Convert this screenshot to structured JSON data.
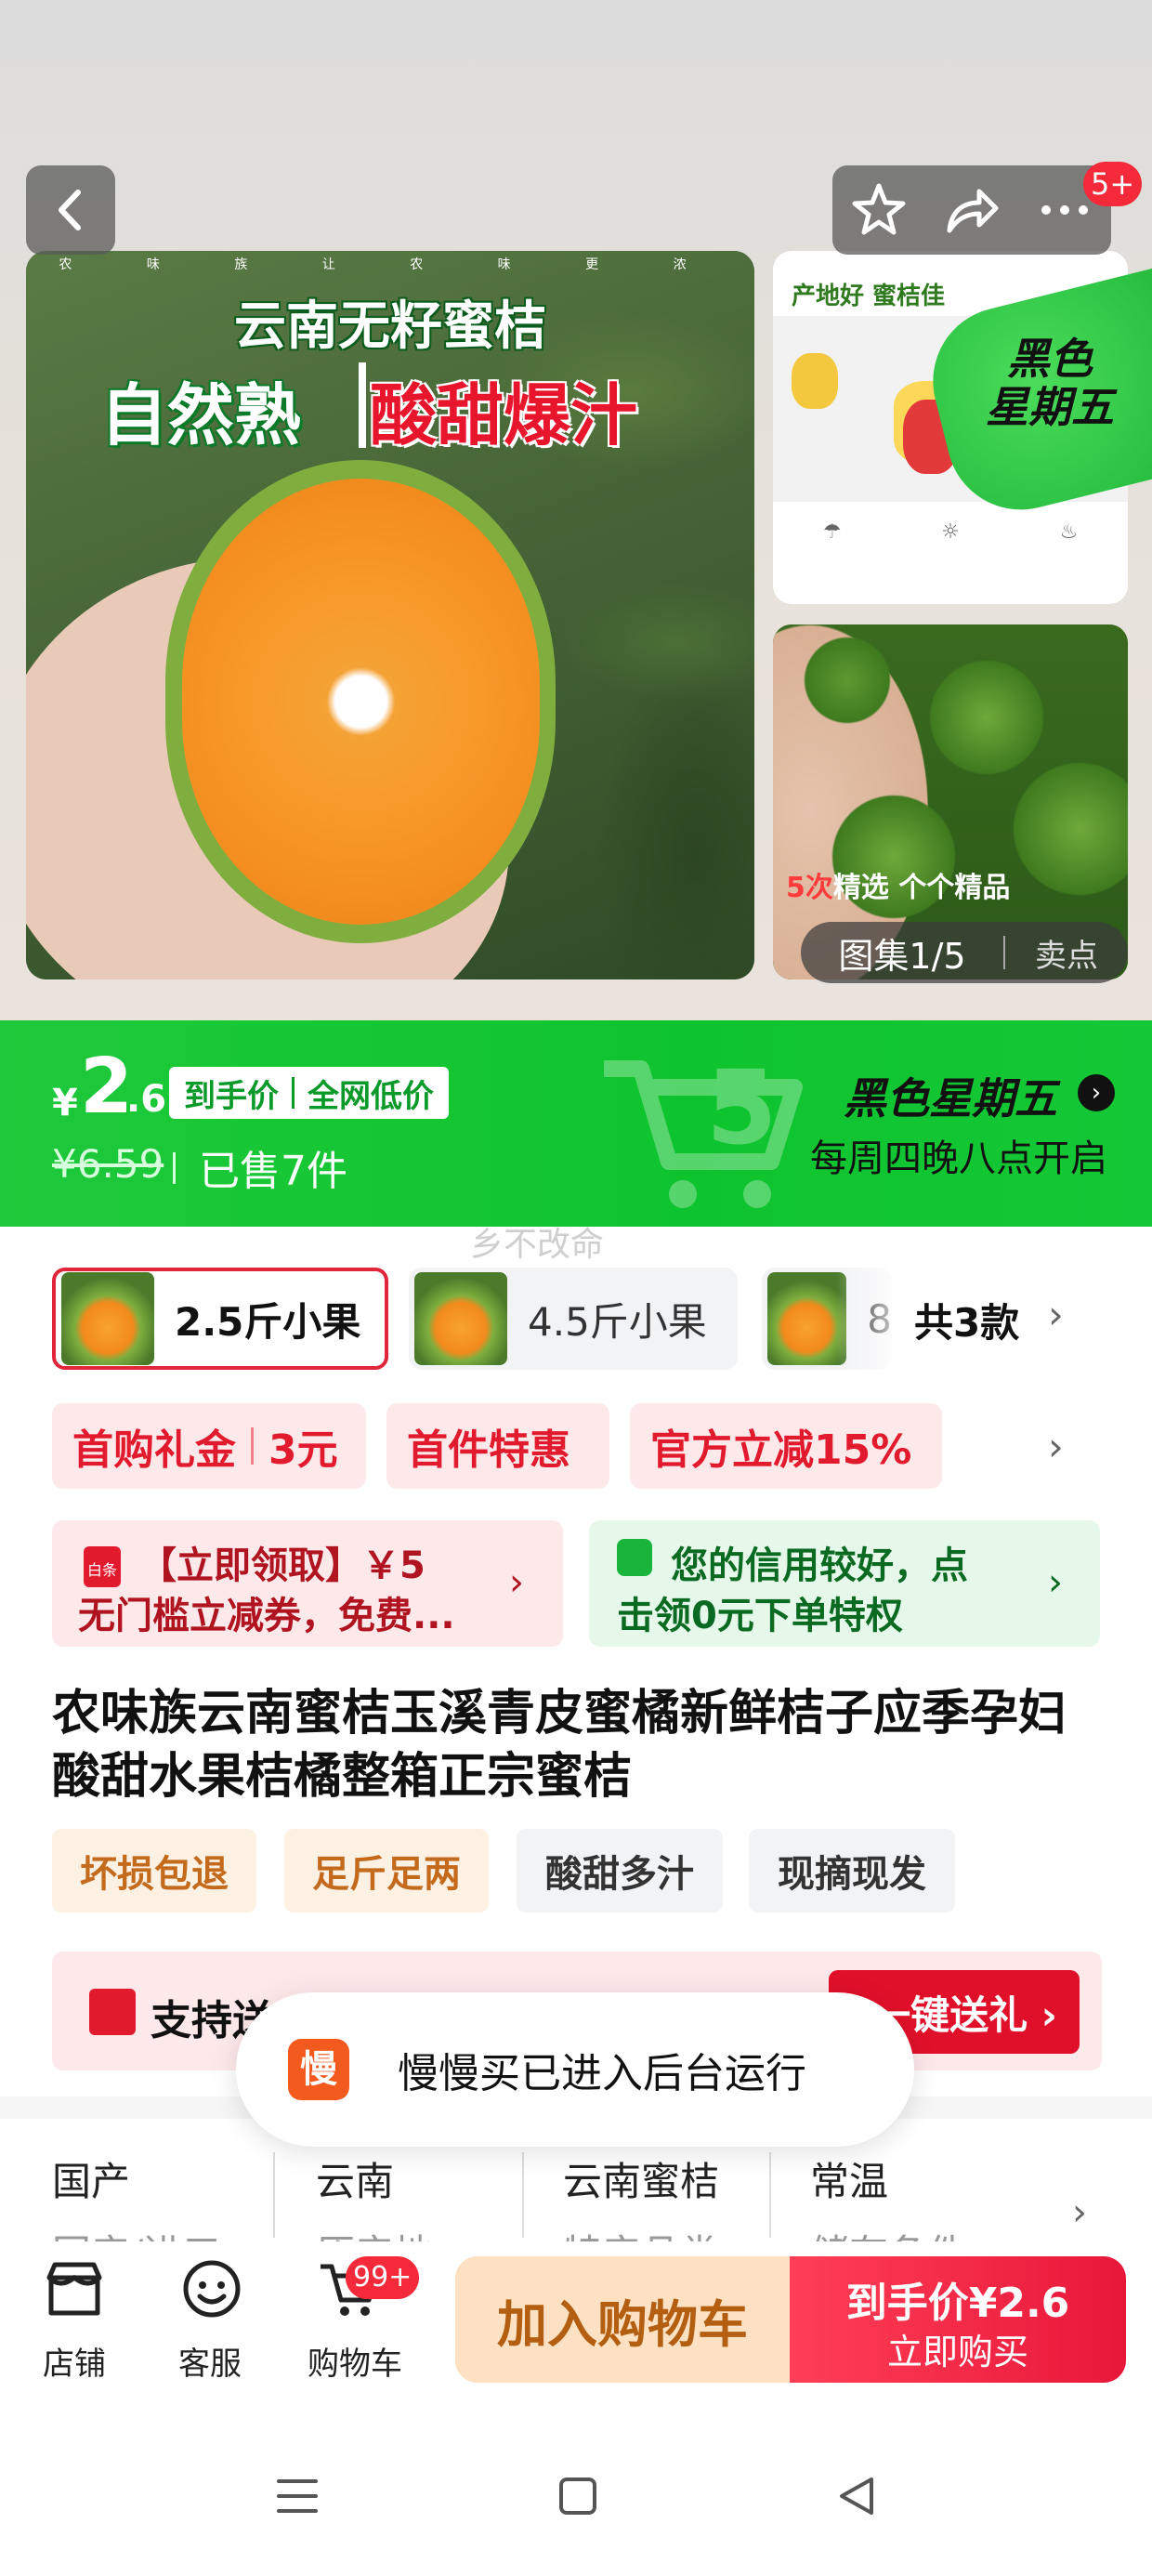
{
  "gallery": {
    "main_image": {
      "header_top": "农 味 族 让 农 味 更 浓",
      "title": "云南无籽蜜桔",
      "slogan_left": "自然熟",
      "slogan_right": "酸甜爆汁"
    },
    "thumb_map": {
      "text": "产地好 蜜桔佳"
    },
    "thumb_fruit": {
      "caption_highlight": "5次",
      "caption": "精选 个个精品"
    },
    "badge_heise": "黑色\n星期五",
    "counter": "图集1/5",
    "selling_points": "卖点",
    "message_badge": "5+"
  },
  "promo": {
    "currency": "¥",
    "price_int": "2",
    "price_dec": ".6",
    "tag_left": "到手价",
    "tag_right": "全网低价",
    "original_price": "¥6.59",
    "sold": "已售7件",
    "event_title": "黑色星期五",
    "event_sub": "每周四晚八点开启",
    "watermark": "乡不改命"
  },
  "variants": {
    "items": [
      {
        "label": "2.5斤小果",
        "selected": true
      },
      {
        "label": "4.5斤小果",
        "selected": false
      },
      {
        "label": "8",
        "selected": false
      }
    ],
    "total": "共3款"
  },
  "coupons": {
    "tag1_left": "首购礼金",
    "tag1_right": "3元",
    "tag2": "首件特惠",
    "tag3": "官方立减15%"
  },
  "benefits": {
    "red_line1": "【立即领取】￥5",
    "red_line2": "无门槛立减券，免费...",
    "red_icon_text": "白条",
    "green_line1": "您的信用较好，点",
    "green_line2": "击领0元下单特权"
  },
  "product": {
    "title": "农味族云南蜜桔玉溪青皮蜜橘新鲜桔子应季孕妇酸甜水果桔橘整箱正宗蜜桔",
    "features": [
      "坏损包退",
      "足斤足两",
      "酸甜多汁",
      "现摘现发"
    ]
  },
  "gift": {
    "label": "支持送",
    "button": "一键送礼 ›"
  },
  "toast": {
    "logo": "慢",
    "text": "慢慢买已进入后台运行"
  },
  "attributes": [
    {
      "value": "国产",
      "name": "国产/进口"
    },
    {
      "value": "云南",
      "name": "原产地"
    },
    {
      "value": "云南蜜桔",
      "name": "特产品类"
    },
    {
      "value": "常温",
      "name": "储存条件"
    }
  ],
  "bottom_bar": {
    "store": "店铺",
    "service": "客服",
    "cart": "购物车",
    "cart_badge": "99+",
    "add_to_cart": "加入购物车",
    "buy_price": "到手价¥2.6",
    "buy_now": "立即购买"
  },
  "colors": {
    "accent_green": "#14c736",
    "accent_red": "#e1102a",
    "add_cart_bg": "#fde1c2"
  }
}
